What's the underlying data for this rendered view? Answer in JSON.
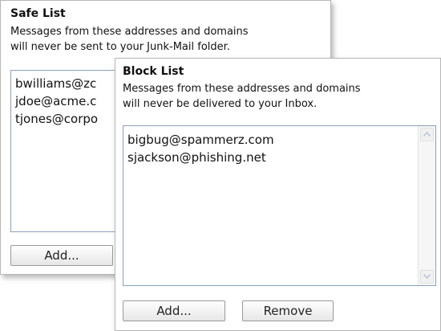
{
  "safe_list": {
    "title": "Safe List",
    "description_line1": "Messages from these addresses and domains",
    "description_line2": "will never be sent to your Junk-Mail folder.",
    "items": [
      "bwilliams@zc",
      "jdoe@acme.c",
      "tjones@corpo"
    ],
    "add_button": "Add..."
  },
  "block_list": {
    "title": "Block List",
    "description_line1": "Messages from these addresses and domains",
    "description_line2": "will never be delivered to your Inbox.",
    "items": [
      "bigbug@spammerz.com",
      "sjackson@phishing.net"
    ],
    "add_button": "Add...",
    "remove_button": "Remove"
  },
  "icons": {
    "scroll_up": "chevron-up-icon",
    "scroll_down": "chevron-down-icon"
  },
  "colors": {
    "listbox_border": "#8aa0be",
    "panel_border": "#b7b7b7",
    "arrow": "#b8c4d6"
  }
}
